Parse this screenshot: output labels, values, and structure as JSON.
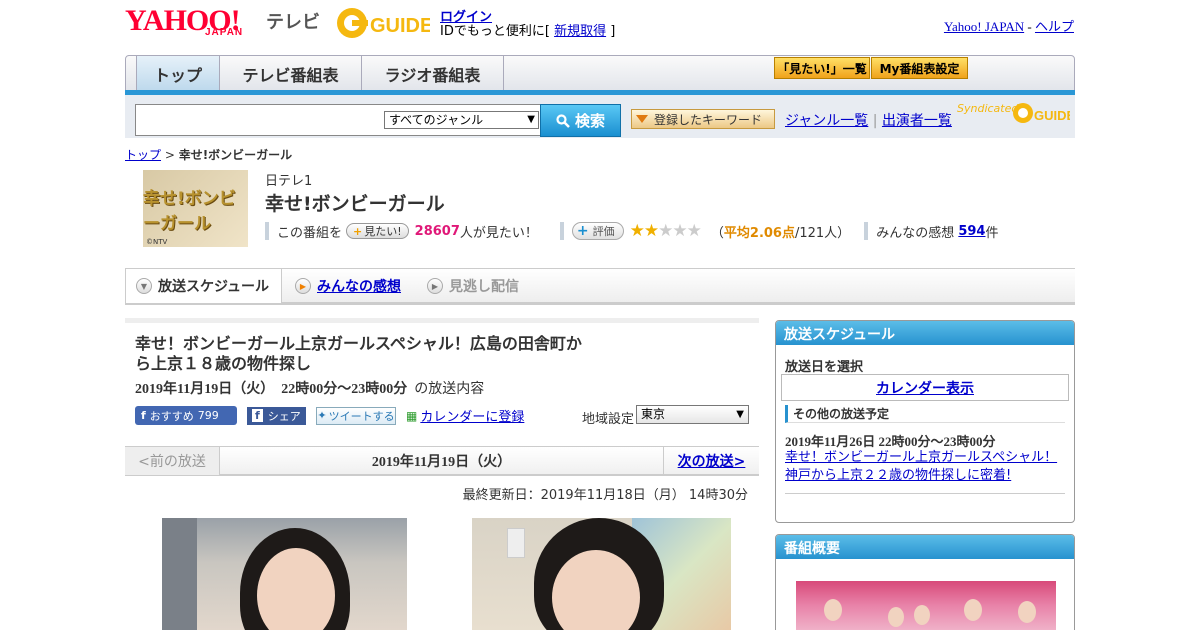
{
  "header": {
    "logo_yahoo": "YAHOO!",
    "logo_japan": "JAPAN",
    "logo_tv": "テレビ",
    "gguide_logo": "G-GUIDE",
    "login_label": "ログイン",
    "login_sub_prefix": "IDでもっと便利に[ ",
    "signup_label": "新規取得",
    "login_sub_suffix": " ]",
    "yahoo_japan_link": "Yahoo! JAPAN",
    "help_link": "ヘルプ",
    "link_separator": " - "
  },
  "nav": {
    "tabs": [
      "トップ",
      "テレビ番組表",
      "ラジオ番組表"
    ],
    "mitai_list": "「見たい!」一覧",
    "my_settings": "My番組表設定"
  },
  "search": {
    "input_value": "",
    "genre_selected": "すべてのジャンル",
    "search_button": "検索",
    "keyword_button": "登録したキーワード",
    "genre_list_link": "ジャンル一覧",
    "cast_list_link": "出演者一覧",
    "divider": "|",
    "syndicated": "Syndicated"
  },
  "breadcrumb": {
    "top": "トップ",
    "separator": " > ",
    "current": "幸せ!ボンビーガール"
  },
  "program": {
    "thumb_text": "幸せ!ボンビーガール",
    "thumb_copyright": "©NTV",
    "station": "日テレ1",
    "title": "幸せ!ボンビーガール",
    "mitai_prefix": "この番組を",
    "mitai_button": "見たい!",
    "mitai_count": "28607",
    "mitai_suffix": "人が見たい！",
    "eval_button": "評価",
    "rating_value": 2.06,
    "stars_filled": 2,
    "stars_total": 5,
    "rating_open": "（",
    "rating_avg_label": "平均2.06点",
    "rating_voters": "/121人）",
    "impressions_label": "みんなの感想",
    "impressions_count": "594",
    "impressions_unit": "件"
  },
  "tabs": {
    "schedule": "放送スケジュール",
    "impressions": "みんなの感想",
    "catchup": "見逃し配信"
  },
  "episode": {
    "title": "幸せ！ボンビーガール上京ガールスペシャル！広島の田舎町から上京１８歳の物件探し",
    "date": "2019年11月19日（火）",
    "time": "22時00分～23時00分",
    "date_suffix": "の放送内容",
    "fb_recommend": "おすすめ",
    "fb_count": "799",
    "fb_share": "シェア",
    "tweet": "ツイートする",
    "calendar_register": "カレンダーに登録",
    "region_label": "地域設定",
    "region_value": "東京",
    "prev": "<前の放送",
    "current": "2019年11月19日（火）",
    "next": "次の放送>",
    "updated": "最終更新日：2019年11月18日（月） 14時30分"
  },
  "sidebar": {
    "schedule_head": "放送スケジュール",
    "select_date": "放送日を選択",
    "calendar_view": "カレンダー表示",
    "other_schedule": "その他の放送予定",
    "other_time": "2019年11月26日 22時00分～23時00分",
    "other_title": "幸せ！ボンビーガール上京ガールスペシャル！神戸から上京２２歳の物件探しに密着!",
    "overview_head": "番組概要"
  }
}
